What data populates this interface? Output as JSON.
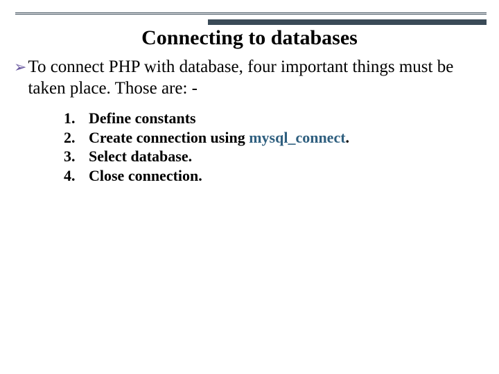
{
  "title": "Connecting to databases",
  "lead": "To connect PHP with database, four important things must be taken place. Those are: -",
  "items": [
    {
      "num": "1.",
      "text": "Define constants"
    },
    {
      "num": "2.",
      "prefix": "Create connection using ",
      "mysql": "mysql_connect",
      "suffix": "."
    },
    {
      "num": "3.",
      "text": "Select database."
    },
    {
      "num": "4.",
      "text": "Close connection."
    }
  ]
}
